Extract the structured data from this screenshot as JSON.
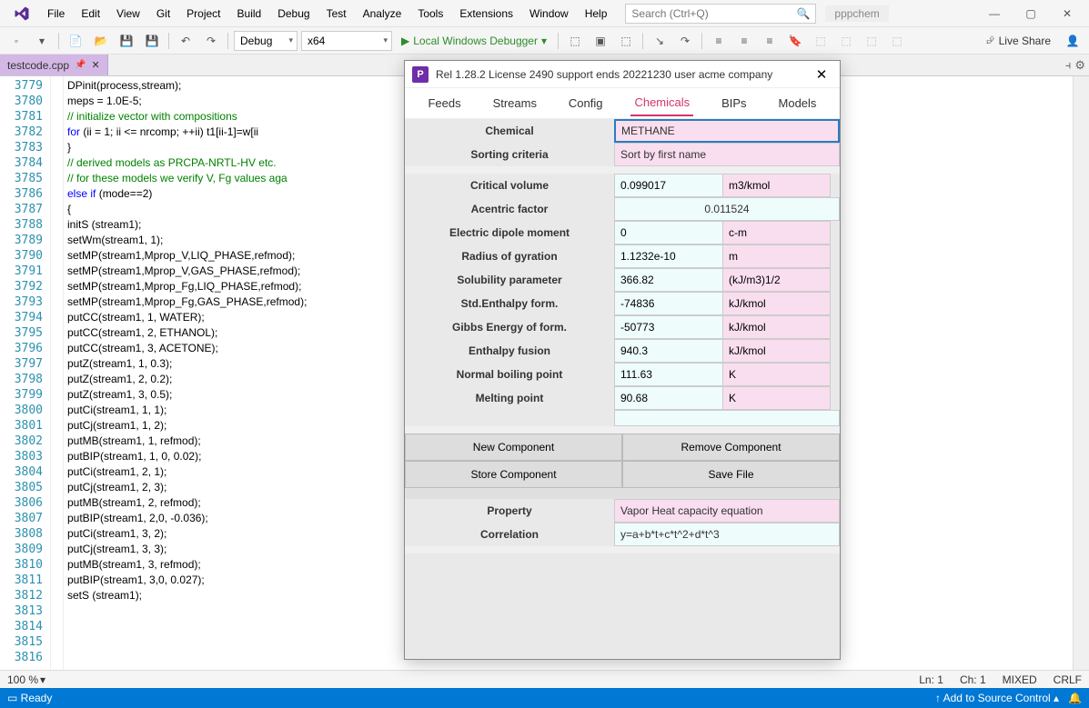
{
  "menubar": {
    "items": [
      "File",
      "Edit",
      "View",
      "Git",
      "Project",
      "Build",
      "Debug",
      "Test",
      "Analyze",
      "Tools",
      "Extensions",
      "Window",
      "Help"
    ],
    "search_placeholder": "Search (Ctrl+Q)",
    "solution": "pppchem"
  },
  "toolbar": {
    "config": "Debug",
    "platform": "x64",
    "run_label": "Local Windows Debugger",
    "live_share": "Live Share"
  },
  "tab": {
    "filename": "testcode.cpp"
  },
  "code": {
    "first_line": 3779,
    "lines": [
      "DPinit(process,stream);",
      "meps = 1.0E-5;",
      "",
      "// initialize vector with compositions",
      "for (ii = 1; ii <= nrcomp; ++ii) t1[ii-1]=w[ii",
      "",
      "}",
      "",
      "// derived models as PRCPA-NRTL-HV etc.",
      "// for these models we verify V, Fg values aga",
      "else if (mode==2)",
      "{",
      "initS (stream1);",
      "setWm(stream1, 1);",
      "setMP(stream1,Mprop_V,LIQ_PHASE,refmod);",
      "setMP(stream1,Mprop_V,GAS_PHASE,refmod);",
      "setMP(stream1,Mprop_Fg,LIQ_PHASE,refmod);",
      "setMP(stream1,Mprop_Fg,GAS_PHASE,refmod);",
      "putCC(stream1, 1, WATER);",
      "putCC(stream1, 2, ETHANOL);",
      "putCC(stream1, 3, ACETONE);",
      "putZ(stream1, 1, 0.3);",
      "putZ(stream1, 2, 0.2);",
      "putZ(stream1, 3, 0.5);",
      "putCi(stream1, 1, 1);",
      "putCj(stream1, 1, 2);",
      "putMB(stream1, 1, refmod);",
      "putBIP(stream1, 1, 0, 0.02);",
      "putCi(stream1, 2, 1);",
      "putCj(stream1, 2, 3);",
      "putMB(stream1, 2, refmod);",
      "putBIP(stream1, 2,0, -0.036);",
      "putCi(stream1, 3, 2);",
      "putCj(stream1, 3, 3);",
      "putMB(stream1, 3, refmod);",
      "putBIP(stream1, 3,0, 0.027);",
      "setS (stream1);",
      ""
    ]
  },
  "editor_status": {
    "zoom": "100 %",
    "ln": "Ln: 1",
    "ch": "Ch: 1",
    "mode": "MIXED",
    "eol": "CRLF"
  },
  "status_bar": {
    "ready": "Ready",
    "scc": "Add to Source Control"
  },
  "rel": {
    "title": "Rel 1.28.2 License 2490 support ends 20221230 user acme company",
    "tabs": [
      "Feeds",
      "Streams",
      "Config",
      "Chemicals",
      "BIPs",
      "Models"
    ],
    "active_tab": 3,
    "chemical_label": "Chemical",
    "chemical_value": "METHANE",
    "sort_label": "Sorting criteria",
    "sort_value": "Sort by first name",
    "props": [
      {
        "label": "Critical volume",
        "value": "0.099017",
        "unit": "m3/kmol"
      },
      {
        "label": "Acentric factor",
        "value": "0.011524",
        "unit": ""
      },
      {
        "label": "Electric dipole moment",
        "value": "0",
        "unit": "c-m"
      },
      {
        "label": "Radius of gyration",
        "value": "1.1232e-10",
        "unit": "m"
      },
      {
        "label": "Solubility parameter",
        "value": "366.82",
        "unit": "(kJ/m3)1/2"
      },
      {
        "label": "Std.Enthalpy form.",
        "value": "-74836",
        "unit": "kJ/kmol"
      },
      {
        "label": "Gibbs Energy of form.",
        "value": "-50773",
        "unit": "kJ/kmol"
      },
      {
        "label": "Enthalpy fusion",
        "value": "940.3",
        "unit": "kJ/kmol"
      },
      {
        "label": "Normal boiling point",
        "value": "111.63",
        "unit": "K"
      },
      {
        "label": "Melting point",
        "value": "90.68",
        "unit": "K"
      }
    ],
    "buttons": {
      "new_comp": "New Component",
      "remove_comp": "Remove Component",
      "store_comp": "Store Component",
      "save_file": "Save File"
    },
    "property_label": "Property",
    "property_value": "Vapor Heat capacity equation",
    "correlation_label": "Correlation",
    "correlation_value": "y=a+b*t+c*t^2+d*t^3"
  }
}
